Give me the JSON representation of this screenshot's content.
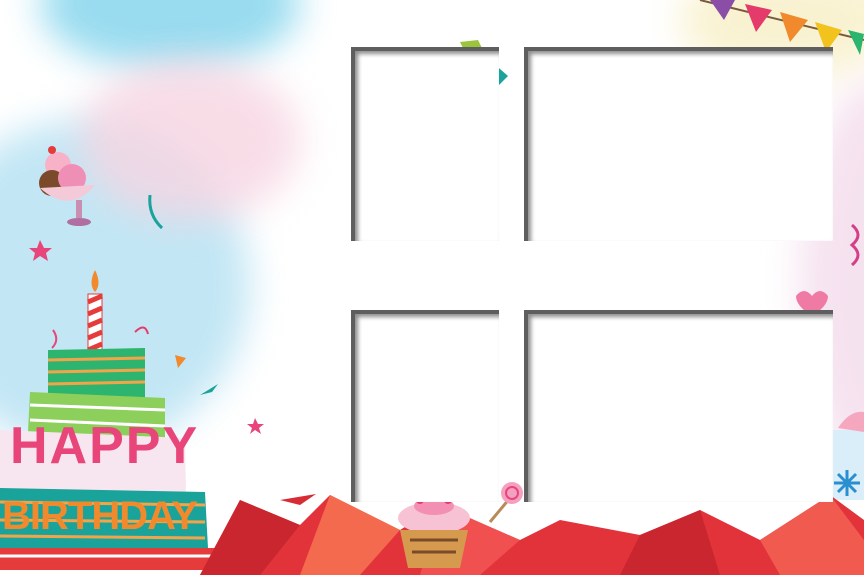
{
  "banner": {
    "line1": "HAPPY",
    "line2": "BIRTHDAY"
  },
  "frames": [
    {
      "name": "photo-frame-top-left"
    },
    {
      "name": "photo-frame-top-right"
    },
    {
      "name": "photo-frame-bottom-left"
    },
    {
      "name": "photo-frame-bottom-right"
    }
  ],
  "colors": {
    "ground_red": "#e2323a",
    "cake_green": "#2db46e",
    "cake_teal": "#1aa39b",
    "letter_pink": "#e8457a",
    "letter_orange": "#f08a2c"
  }
}
